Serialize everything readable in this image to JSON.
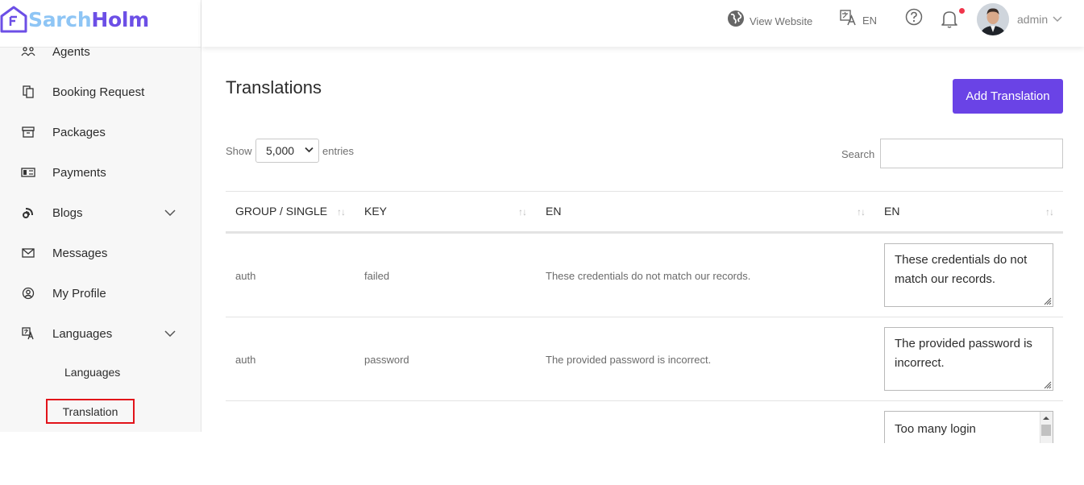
{
  "brand": {
    "part1": "Sarch",
    "part2": "Holm"
  },
  "sidebar": {
    "items": [
      {
        "label": "Agents",
        "icon": "agents-icon"
      },
      {
        "label": "Booking Request",
        "icon": "copy-icon"
      },
      {
        "label": "Packages",
        "icon": "archive-icon"
      },
      {
        "label": "Payments",
        "icon": "cash-icon"
      },
      {
        "label": "Blogs",
        "icon": "blog-icon"
      },
      {
        "label": "Messages",
        "icon": "mail-icon"
      },
      {
        "label": "My Profile",
        "icon": "user-circle-icon"
      },
      {
        "label": "Languages",
        "icon": "translate-icon"
      }
    ],
    "sub_items": [
      {
        "label": "Languages"
      },
      {
        "label": "Translation",
        "active": true
      }
    ]
  },
  "header": {
    "view_website": "View Website",
    "language": "EN",
    "user": "admin"
  },
  "page": {
    "title": "Translations",
    "add_button": "Add Translation",
    "show_label": "Show",
    "entries_value": "5,000",
    "entries_label": "entries",
    "search_label": "Search",
    "search_value": ""
  },
  "table": {
    "headers": [
      "GROUP / SINGLE",
      "KEY",
      "EN",
      "EN"
    ],
    "rows": [
      {
        "group": "auth",
        "key": "failed",
        "en": "These credentials do not match our records.",
        "value": "These credentials do not match our records."
      },
      {
        "group": "auth",
        "key": "password",
        "en": "The provided password is incorrect.",
        "value": "The provided password is incorrect."
      },
      {
        "group": "",
        "key": "",
        "en": "",
        "value": "Too many login"
      }
    ]
  },
  "colors": {
    "accent": "#6a43e6",
    "logo_light": "#8ec5f5",
    "logo_dark": "#6c4fe6",
    "notification_dot": "#f0354b",
    "active_outline": "#e2131a"
  }
}
